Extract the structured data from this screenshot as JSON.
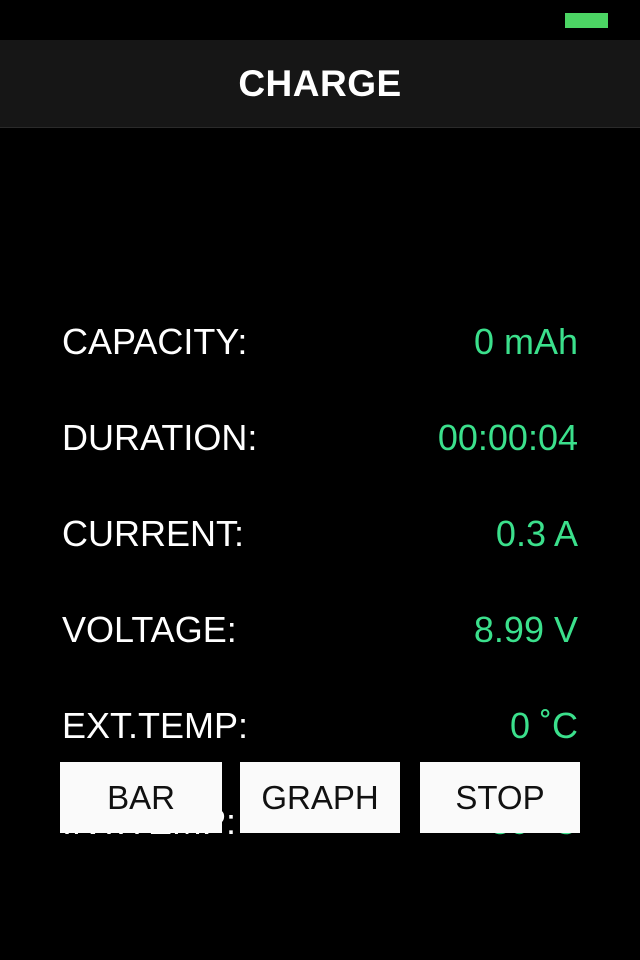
{
  "status_bar": {
    "battery_indicator": {
      "name": "battery-indicator",
      "color": "#4CD564"
    }
  },
  "header": {
    "title": "CHARGE",
    "background_color": "#161616",
    "text_color": "#FFFFFF"
  },
  "theme": {
    "background_color": "#000000",
    "label_color": "#FFFFFF",
    "value_color": "#3BE08C",
    "button_background": "#FAFAFA",
    "button_text_color": "#111111"
  },
  "readouts": [
    {
      "label": "CAPACITY:",
      "value": "0 mAh"
    },
    {
      "label": "DURATION:",
      "value": "00:00:04"
    },
    {
      "label": "CURRENT:",
      "value": "0.3 A"
    },
    {
      "label": "VOLTAGE:",
      "value": "8.99 V"
    },
    {
      "label": "EXT.TEMP:",
      "value": "0 ˚C"
    },
    {
      "label": "INT.TEMP:",
      "value": "39 ˚C"
    }
  ],
  "buttons": [
    {
      "label": "BAR"
    },
    {
      "label": "GRAPH"
    },
    {
      "label": "STOP"
    }
  ]
}
